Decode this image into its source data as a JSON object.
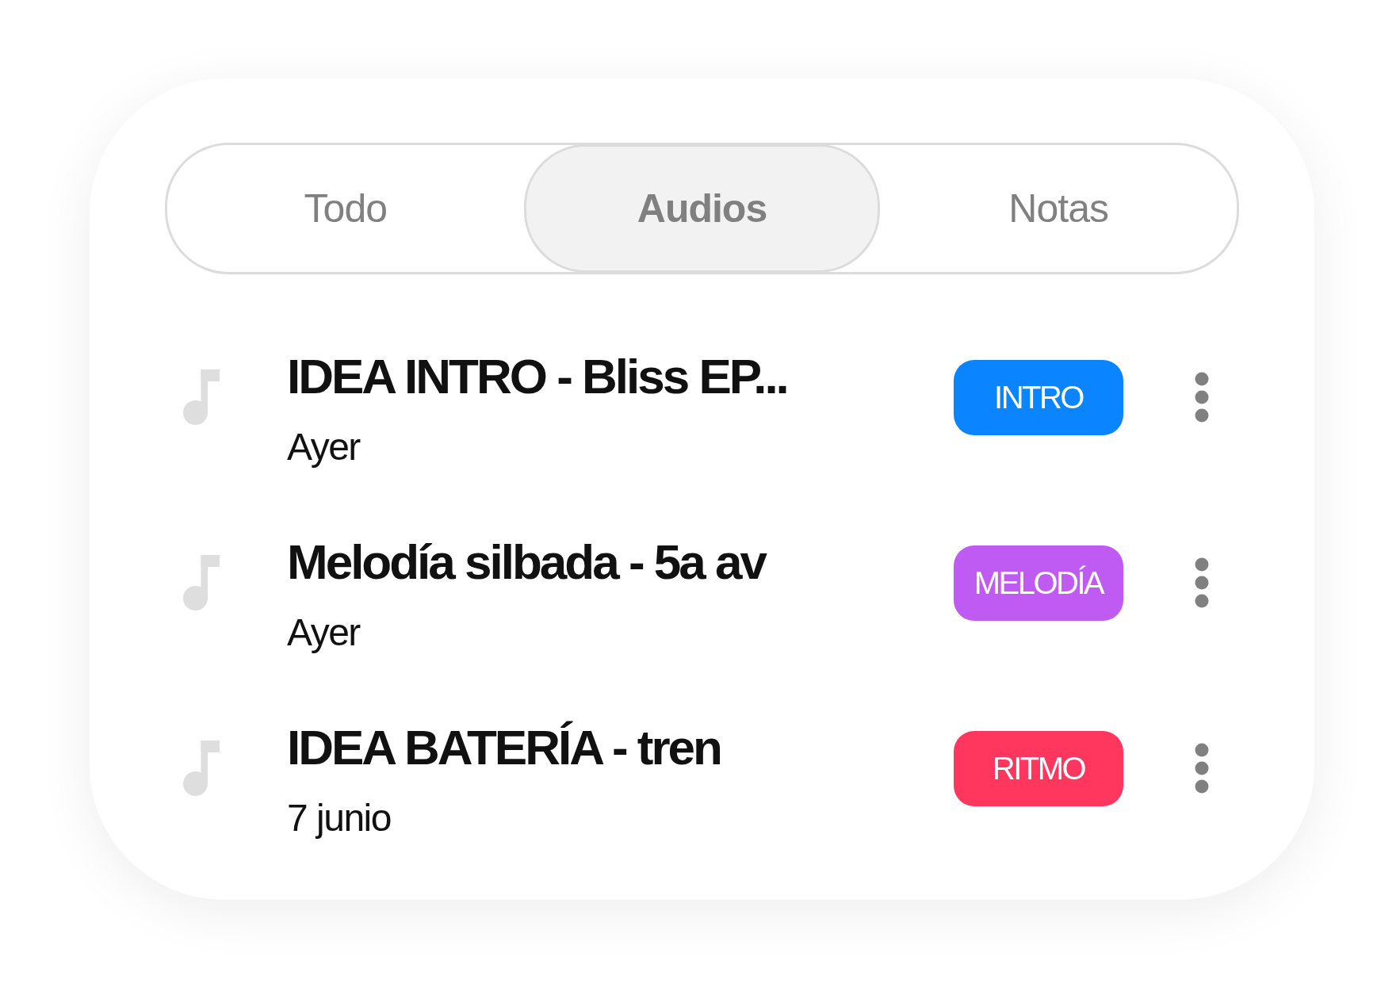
{
  "tabs": [
    {
      "label": "Todo",
      "selected": false
    },
    {
      "label": "Audios",
      "selected": true
    },
    {
      "label": "Notas",
      "selected": false
    }
  ],
  "items": [
    {
      "title": "IDEA INTRO - Bliss EP...",
      "date": "Ayer",
      "tag": {
        "label": "INTRO",
        "color": "#0a84ff"
      }
    },
    {
      "title": "Melodía silbada - 5a av",
      "date": "Ayer",
      "tag": {
        "label": "MELODÍA",
        "color": "#bf5af2"
      }
    },
    {
      "title": "IDEA BATERÍA - tren",
      "date": "7 junio",
      "tag": {
        "label": "RITMO",
        "color": "#ff375f"
      }
    }
  ]
}
